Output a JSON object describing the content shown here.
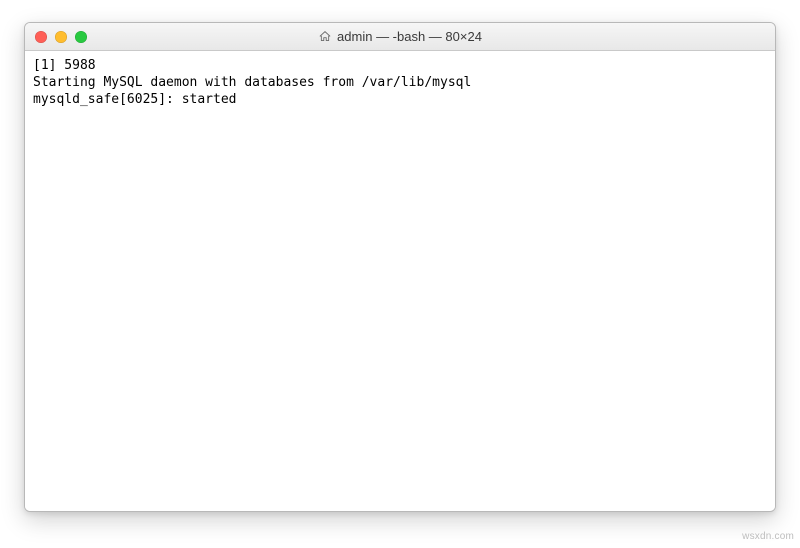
{
  "window": {
    "title": "admin — -bash — 80×24",
    "icon": "home-icon"
  },
  "traffic_lights": {
    "close_color": "#ff5f57",
    "minimize_color": "#ffbd2e",
    "maximize_color": "#28c940"
  },
  "terminal": {
    "lines": [
      "[1] 5988",
      "Starting MySQL daemon with databases from /var/lib/mysql",
      "mysqld_safe[6025]: started"
    ]
  },
  "watermark": "wsxdn.com"
}
